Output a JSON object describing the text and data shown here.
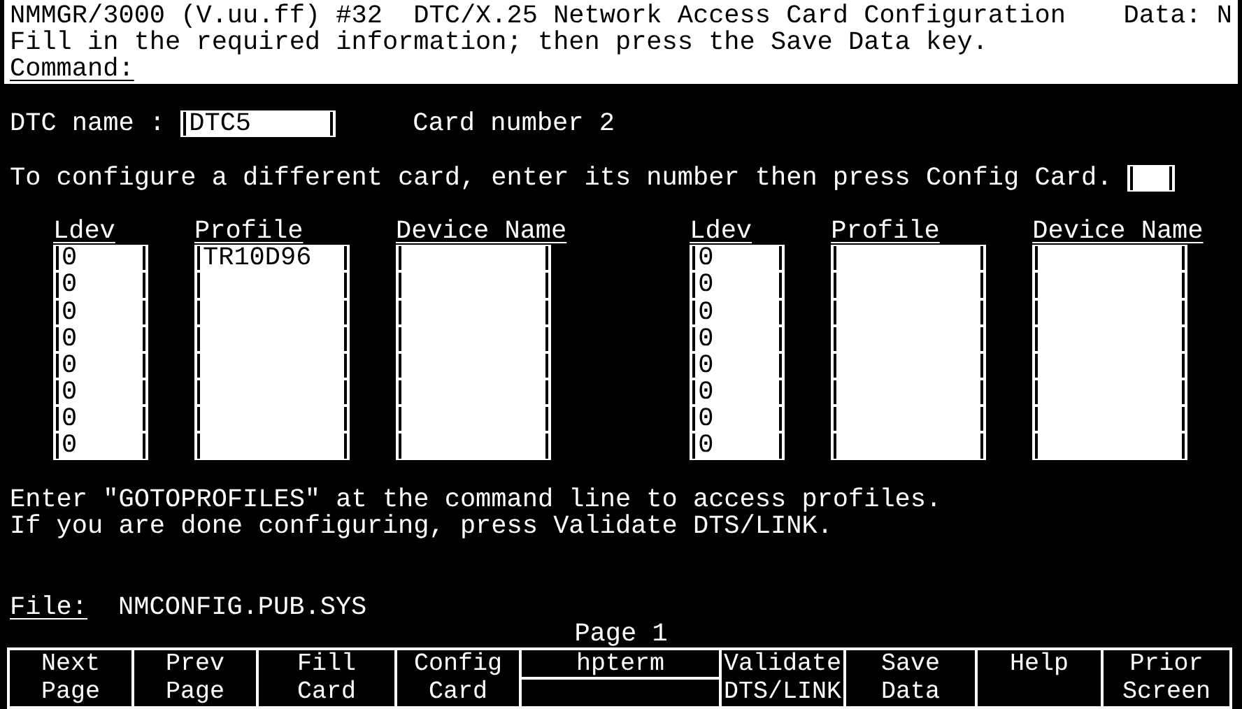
{
  "header": {
    "title": "NMMGR/3000 (V.uu.ff) #32  DTC/X.25 Network Access Card Configuration",
    "data_flag": "Data: N",
    "instruction": "Fill in the required information; then press the Save Data key.",
    "command_label": "Command:"
  },
  "dtc_name": {
    "label": "DTC name :",
    "value": "DTC5"
  },
  "card_number": "Card number 2",
  "config_prompt": {
    "text": "To configure a different card, enter its number then press Config Card."
  },
  "tables": [
    {
      "columns": [
        "Ldev",
        "Profile",
        "Device Name"
      ],
      "rows": [
        {
          "ldev": "0",
          "profile": "TR10D96"
        },
        {
          "ldev": "0"
        },
        {
          "ldev": "0"
        },
        {
          "ldev": "0"
        },
        {
          "ldev": "0"
        },
        {
          "ldev": "0"
        },
        {
          "ldev": "0"
        },
        {
          "ldev": "0"
        }
      ]
    },
    {
      "columns": [
        "Ldev",
        "Profile",
        "Device Name"
      ],
      "rows": [
        {
          "ldev": "0"
        },
        {
          "ldev": "0"
        },
        {
          "ldev": "0"
        },
        {
          "ldev": "0"
        },
        {
          "ldev": "0"
        },
        {
          "ldev": "0"
        },
        {
          "ldev": "0"
        },
        {
          "ldev": "0"
        }
      ]
    }
  ],
  "messages": [
    "Enter \"GOTOPROFILES\" at the command line to access profiles.",
    "If you are done configuring, press Validate DTS/LINK."
  ],
  "file": {
    "label": "File:",
    "value": "NMCONFIG.PUB.SYS"
  },
  "page": "Page 1",
  "function_keys": [
    {
      "kind": "normal",
      "lines": [
        "Next",
        "Page"
      ]
    },
    {
      "kind": "normal",
      "lines": [
        "Prev",
        "Page"
      ]
    },
    {
      "kind": "normal",
      "lines": [
        "Fill",
        "Card"
      ]
    },
    {
      "kind": "normal",
      "lines": [
        "Config",
        "Card"
      ]
    },
    {
      "kind": "split",
      "lines": [
        "hpterm"
      ]
    },
    {
      "kind": "normal",
      "lines": [
        "Validate",
        "DTS/LINK"
      ]
    },
    {
      "kind": "normal",
      "lines": [
        "Save",
        "Data"
      ]
    },
    {
      "kind": "normal",
      "lines": [
        "Help"
      ]
    },
    {
      "kind": "normal",
      "lines": [
        "Prior",
        "Screen"
      ]
    }
  ]
}
